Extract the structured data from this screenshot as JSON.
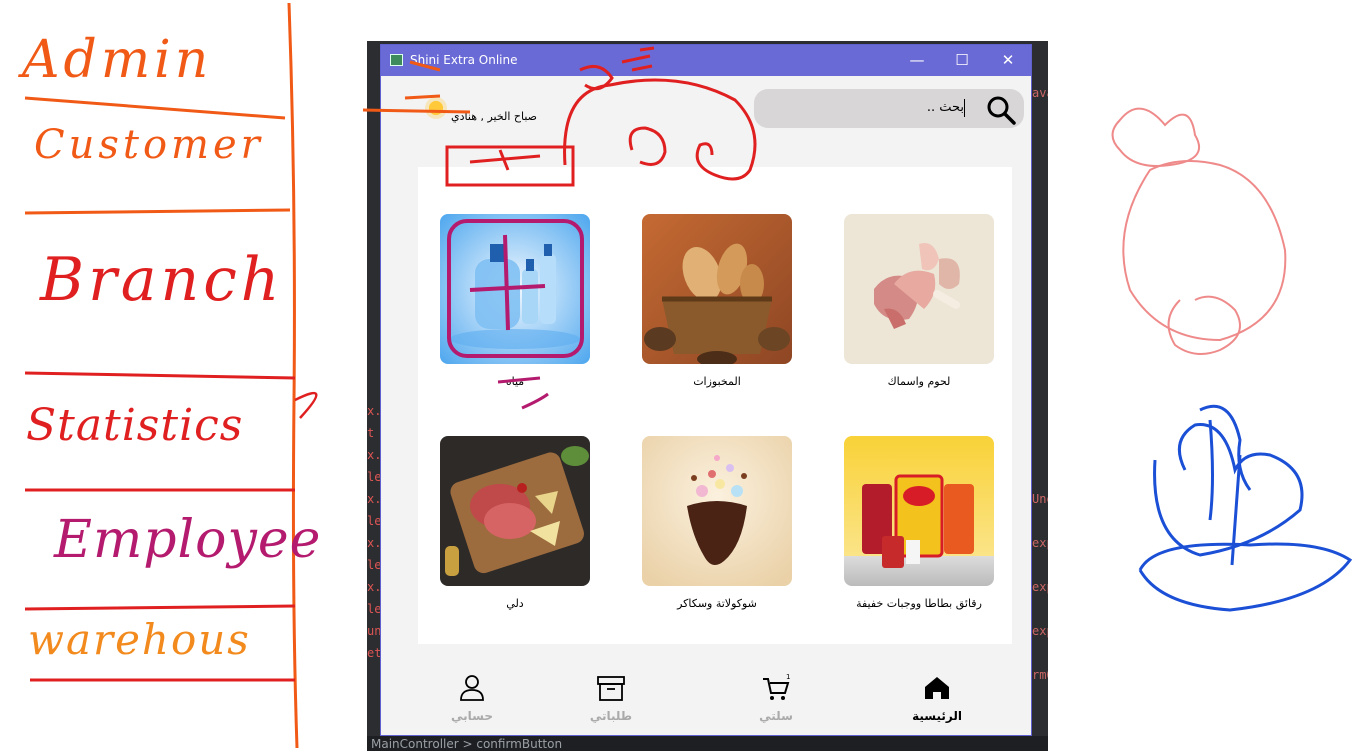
{
  "window": {
    "title": "Shini Extra Online",
    "controls": [
      "minimize-icon",
      "maximize-icon",
      "close-icon"
    ]
  },
  "header": {
    "greeting": "صباح الخير , هنادي",
    "search_placeholder": "بحث .."
  },
  "categories": [
    {
      "label": "لحوم واسماك"
    },
    {
      "label": "المخبوزات"
    },
    {
      "label": "مياه"
    },
    {
      "label": "رقائق بطاطا ووجبات خفيفة"
    },
    {
      "label": "شوكولاتة وسكاكر"
    },
    {
      "label": "دلي"
    }
  ],
  "tabs": [
    {
      "label": "الرئيسية",
      "icon": "home-icon",
      "active": true
    },
    {
      "label": "سلتي",
      "icon": "cart-icon",
      "active": false
    },
    {
      "label": "طلباتي",
      "icon": "archive-box-icon",
      "active": false
    },
    {
      "label": "حسابي",
      "icon": "user-icon",
      "active": false
    }
  ],
  "annotations": {
    "list": [
      "Admin",
      "Customer",
      "Branch",
      "Statistics",
      "Employee",
      "warehous"
    ]
  },
  "ide": {
    "status_text": "MainController  >  confirmButton",
    "right_gutter": [
      "ava",
      "Une",
      "exp",
      "exp",
      "exp",
      "rmO"
    ],
    "left_gutter": [
      "x.",
      "t",
      "x.",
      "le",
      "x.",
      "le",
      "x.",
      "le",
      "x.",
      "le",
      "un",
      "et"
    ]
  },
  "colors": {
    "titlebar": "#6a6ad6",
    "search_bg": "#d8d6d6",
    "accent_orange": "#f15a16",
    "accent_red": "#e02020",
    "accent_magenta": "#b41a6e",
    "accent_blue": "#1a4fd6"
  }
}
